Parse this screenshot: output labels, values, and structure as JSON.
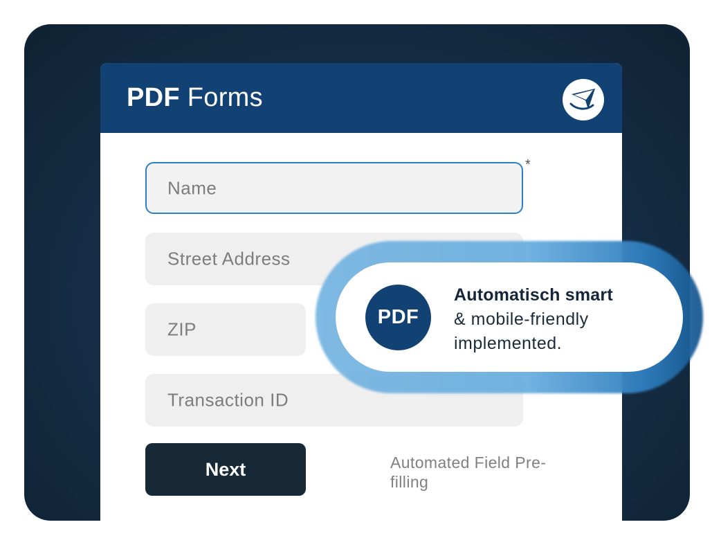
{
  "header": {
    "title_bold": "PDF",
    "title_light": "Forms",
    "logo_icon": "paper-plane-logo-icon"
  },
  "form": {
    "name": {
      "placeholder": "Name",
      "required_mark": "*"
    },
    "street": {
      "placeholder": "Street Address"
    },
    "zip": {
      "placeholder": "ZIP"
    },
    "transaction": {
      "placeholder": "Transaction ID"
    },
    "next_label": "Next",
    "prefill_note": "Automated Field Pre-filling"
  },
  "callout": {
    "badge": "PDF",
    "headline": "Automatisch smart",
    "line2": "& mobile-friendly",
    "line3": "implemented."
  },
  "colors": {
    "frame": "#16304a",
    "header": "#124273",
    "button": "#172836",
    "field": "#efefef",
    "focus_border": "#2a7fc9",
    "glow": "#6aaedf"
  }
}
